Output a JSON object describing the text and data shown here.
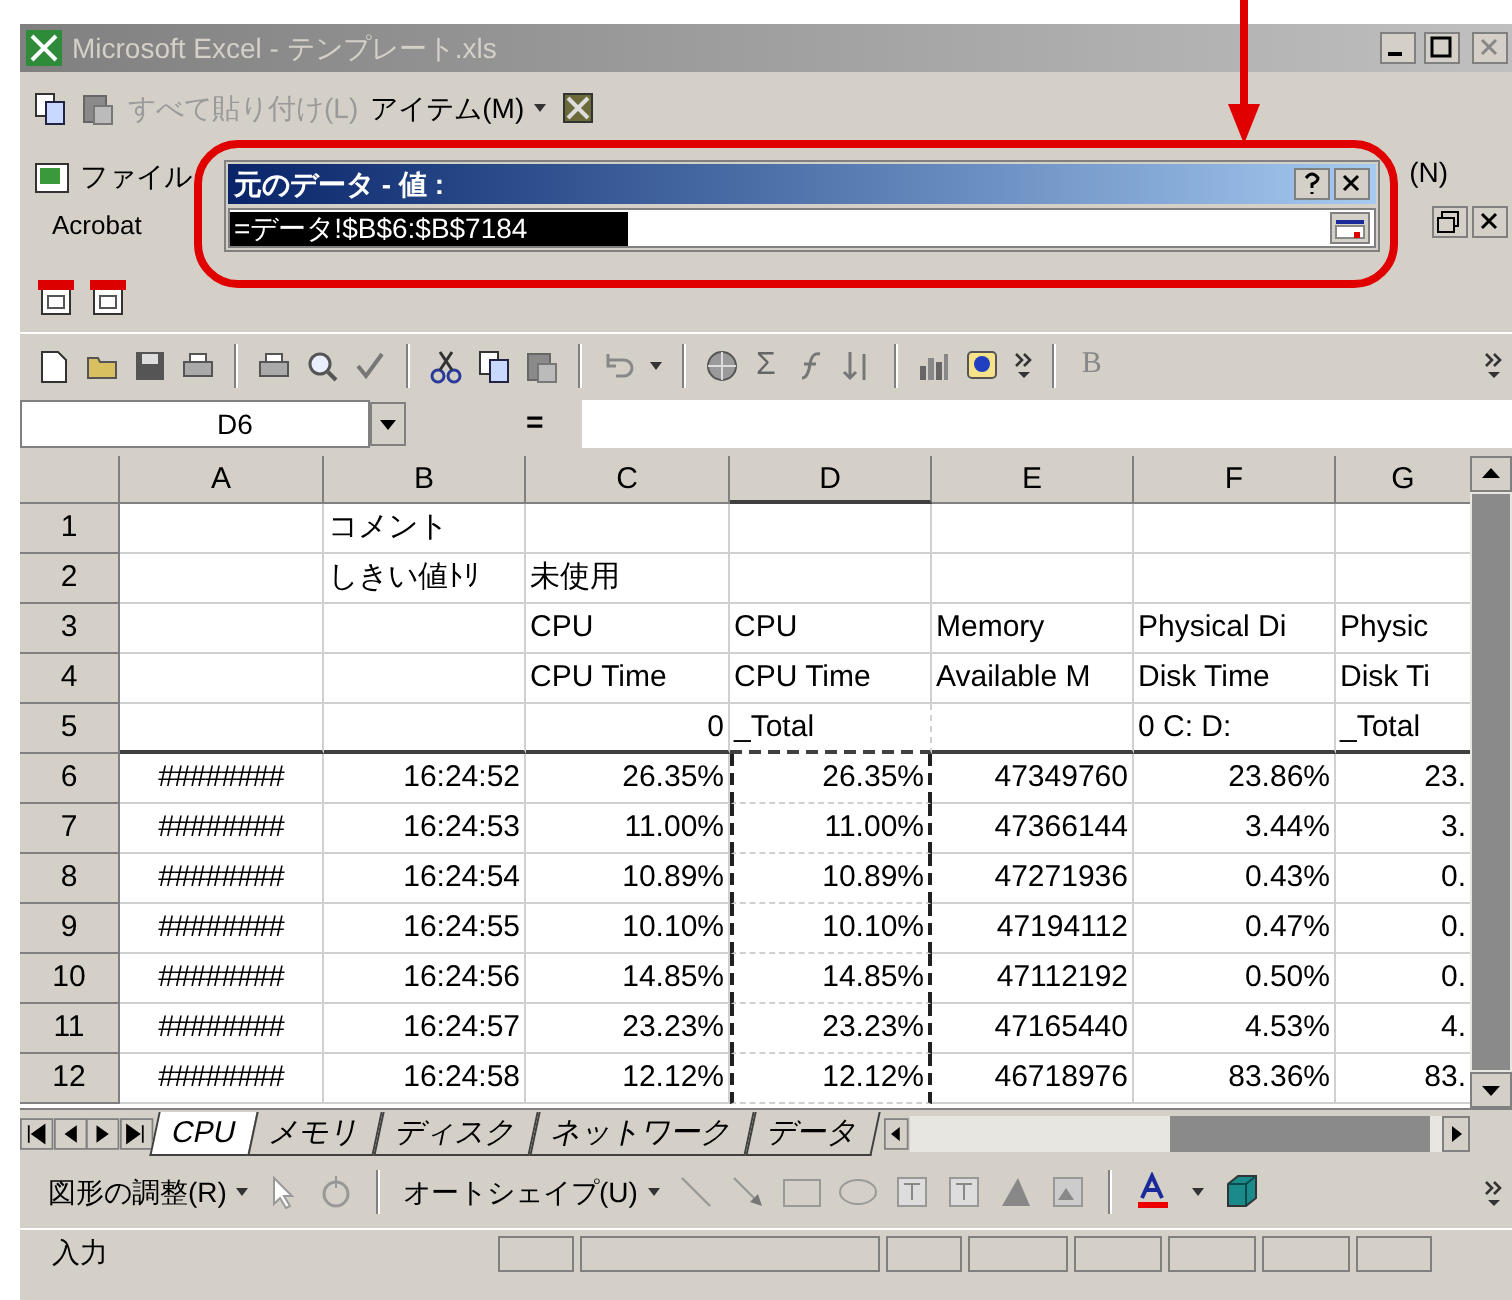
{
  "window": {
    "title": "Microsoft Excel - テンプレート.xls"
  },
  "clipboard_toolbar": {
    "paste_all": {
      "label": "すべて貼り付け(L)",
      "disabled": true
    },
    "items_menu": {
      "label": "アイテム(M)"
    }
  },
  "acrobat_toolbar": {
    "menu": "ファイル",
    "caption": "Acrobat",
    "hidden_menu": "(N)"
  },
  "dialog": {
    "title": "元のデータ - 値 :",
    "value": "=データ!$B$6:$B$7184"
  },
  "standard_toolbar": {
    "sum": "Σ",
    "bold": "B"
  },
  "formula_bar": {
    "name_box": "D6",
    "equals": "="
  },
  "grid": {
    "columns": [
      {
        "label": "A",
        "marquee": false
      },
      {
        "label": "B",
        "marquee": false
      },
      {
        "label": "C",
        "marquee": false
      },
      {
        "label": "D",
        "marquee": true
      },
      {
        "label": "E",
        "marquee": false
      },
      {
        "label": "F",
        "marquee": false
      },
      {
        "label": "G",
        "marquee": false
      }
    ],
    "rows": [
      {
        "number": "1",
        "cells": [
          {
            "text": "",
            "kind": "text"
          },
          {
            "text": "コメント",
            "kind": "text"
          },
          {
            "text": "",
            "kind": "text"
          },
          {
            "text": "",
            "kind": "text"
          },
          {
            "text": "",
            "kind": "text"
          },
          {
            "text": "",
            "kind": "text"
          },
          {
            "text": "",
            "kind": "text"
          }
        ]
      },
      {
        "number": "2",
        "cells": [
          {
            "text": "",
            "kind": "text"
          },
          {
            "text": "しきい値ﾄﾘ",
            "kind": "text"
          },
          {
            "text": "未使用",
            "kind": "text"
          },
          {
            "text": "",
            "kind": "text"
          },
          {
            "text": "",
            "kind": "text"
          },
          {
            "text": "",
            "kind": "text"
          },
          {
            "text": "",
            "kind": "text"
          }
        ]
      },
      {
        "number": "3",
        "cells": [
          {
            "text": "",
            "kind": "text"
          },
          {
            "text": "",
            "kind": "text"
          },
          {
            "text": "CPU",
            "kind": "text"
          },
          {
            "text": "CPU",
            "kind": "text"
          },
          {
            "text": "Memory",
            "kind": "text"
          },
          {
            "text": "Physical Di",
            "kind": "text"
          },
          {
            "text": "Physic",
            "kind": "text"
          }
        ]
      },
      {
        "number": "4",
        "cells": [
          {
            "text": "",
            "kind": "text"
          },
          {
            "text": "",
            "kind": "text"
          },
          {
            "text": "CPU Time",
            "kind": "text"
          },
          {
            "text": "CPU Time",
            "kind": "text"
          },
          {
            "text": "Available M",
            "kind": "text"
          },
          {
            "text": "Disk Time",
            "kind": "text"
          },
          {
            "text": "Disk Ti",
            "kind": "text"
          }
        ]
      },
      {
        "number": "5",
        "cells": [
          {
            "text": "",
            "kind": "text"
          },
          {
            "text": "",
            "kind": "text"
          },
          {
            "text": "0",
            "kind": "number"
          },
          {
            "text": "_Total",
            "kind": "text"
          },
          {
            "text": "",
            "kind": "text"
          },
          {
            "text": "0 C: D:",
            "kind": "text"
          },
          {
            "text": "_Total",
            "kind": "text"
          }
        ]
      },
      {
        "number": "6",
        "cells": [
          {
            "text": "########",
            "kind": "fill"
          },
          {
            "text": "16:24:52",
            "kind": "number"
          },
          {
            "text": "26.35%",
            "kind": "number"
          },
          {
            "text": "26.35%",
            "kind": "number"
          },
          {
            "text": "47349760",
            "kind": "number"
          },
          {
            "text": "23.86%",
            "kind": "number"
          },
          {
            "text": "23.",
            "kind": "number"
          }
        ]
      },
      {
        "number": "7",
        "cells": [
          {
            "text": "########",
            "kind": "fill"
          },
          {
            "text": "16:24:53",
            "kind": "number"
          },
          {
            "text": "11.00%",
            "kind": "number"
          },
          {
            "text": "11.00%",
            "kind": "number"
          },
          {
            "text": "47366144",
            "kind": "number"
          },
          {
            "text": "3.44%",
            "kind": "number"
          },
          {
            "text": "3.",
            "kind": "number"
          }
        ]
      },
      {
        "number": "8",
        "cells": [
          {
            "text": "########",
            "kind": "fill"
          },
          {
            "text": "16:24:54",
            "kind": "number"
          },
          {
            "text": "10.89%",
            "kind": "number"
          },
          {
            "text": "10.89%",
            "kind": "number"
          },
          {
            "text": "47271936",
            "kind": "number"
          },
          {
            "text": "0.43%",
            "kind": "number"
          },
          {
            "text": "0.",
            "kind": "number"
          }
        ]
      },
      {
        "number": "9",
        "cells": [
          {
            "text": "########",
            "kind": "fill"
          },
          {
            "text": "16:24:55",
            "kind": "number"
          },
          {
            "text": "10.10%",
            "kind": "number"
          },
          {
            "text": "10.10%",
            "kind": "number"
          },
          {
            "text": "47194112",
            "kind": "number"
          },
          {
            "text": "0.47%",
            "kind": "number"
          },
          {
            "text": "0.",
            "kind": "number"
          }
        ]
      },
      {
        "number": "10",
        "cells": [
          {
            "text": "########",
            "kind": "fill"
          },
          {
            "text": "16:24:56",
            "kind": "number"
          },
          {
            "text": "14.85%",
            "kind": "number"
          },
          {
            "text": "14.85%",
            "kind": "number"
          },
          {
            "text": "47112192",
            "kind": "number"
          },
          {
            "text": "0.50%",
            "kind": "number"
          },
          {
            "text": "0.",
            "kind": "number"
          }
        ]
      },
      {
        "number": "11",
        "cells": [
          {
            "text": "########",
            "kind": "fill"
          },
          {
            "text": "16:24:57",
            "kind": "number"
          },
          {
            "text": "23.23%",
            "kind": "number"
          },
          {
            "text": "23.23%",
            "kind": "number"
          },
          {
            "text": "47165440",
            "kind": "number"
          },
          {
            "text": "4.53%",
            "kind": "number"
          },
          {
            "text": "4.",
            "kind": "number"
          }
        ]
      },
      {
        "number": "12",
        "cells": [
          {
            "text": "########",
            "kind": "fill"
          },
          {
            "text": "16:24:58",
            "kind": "number"
          },
          {
            "text": "12.12%",
            "kind": "number"
          },
          {
            "text": "12.12%",
            "kind": "number"
          },
          {
            "text": "46718976",
            "kind": "number"
          },
          {
            "text": "83.36%",
            "kind": "number"
          },
          {
            "text": "83.",
            "kind": "number"
          }
        ]
      }
    ]
  },
  "sheet_tabs": [
    {
      "label": "CPU",
      "selected": true
    },
    {
      "label": "メモリ",
      "selected": false
    },
    {
      "label": "ディスク",
      "selected": false
    },
    {
      "label": "ネットワーク",
      "selected": false
    },
    {
      "label": "データ",
      "selected": false
    }
  ],
  "drawing_toolbar": {
    "draw_menu": "図形の調整(R)",
    "autoshapes_menu": "オートシェイプ(U)"
  },
  "status_bar": {
    "mode": "入力"
  }
}
